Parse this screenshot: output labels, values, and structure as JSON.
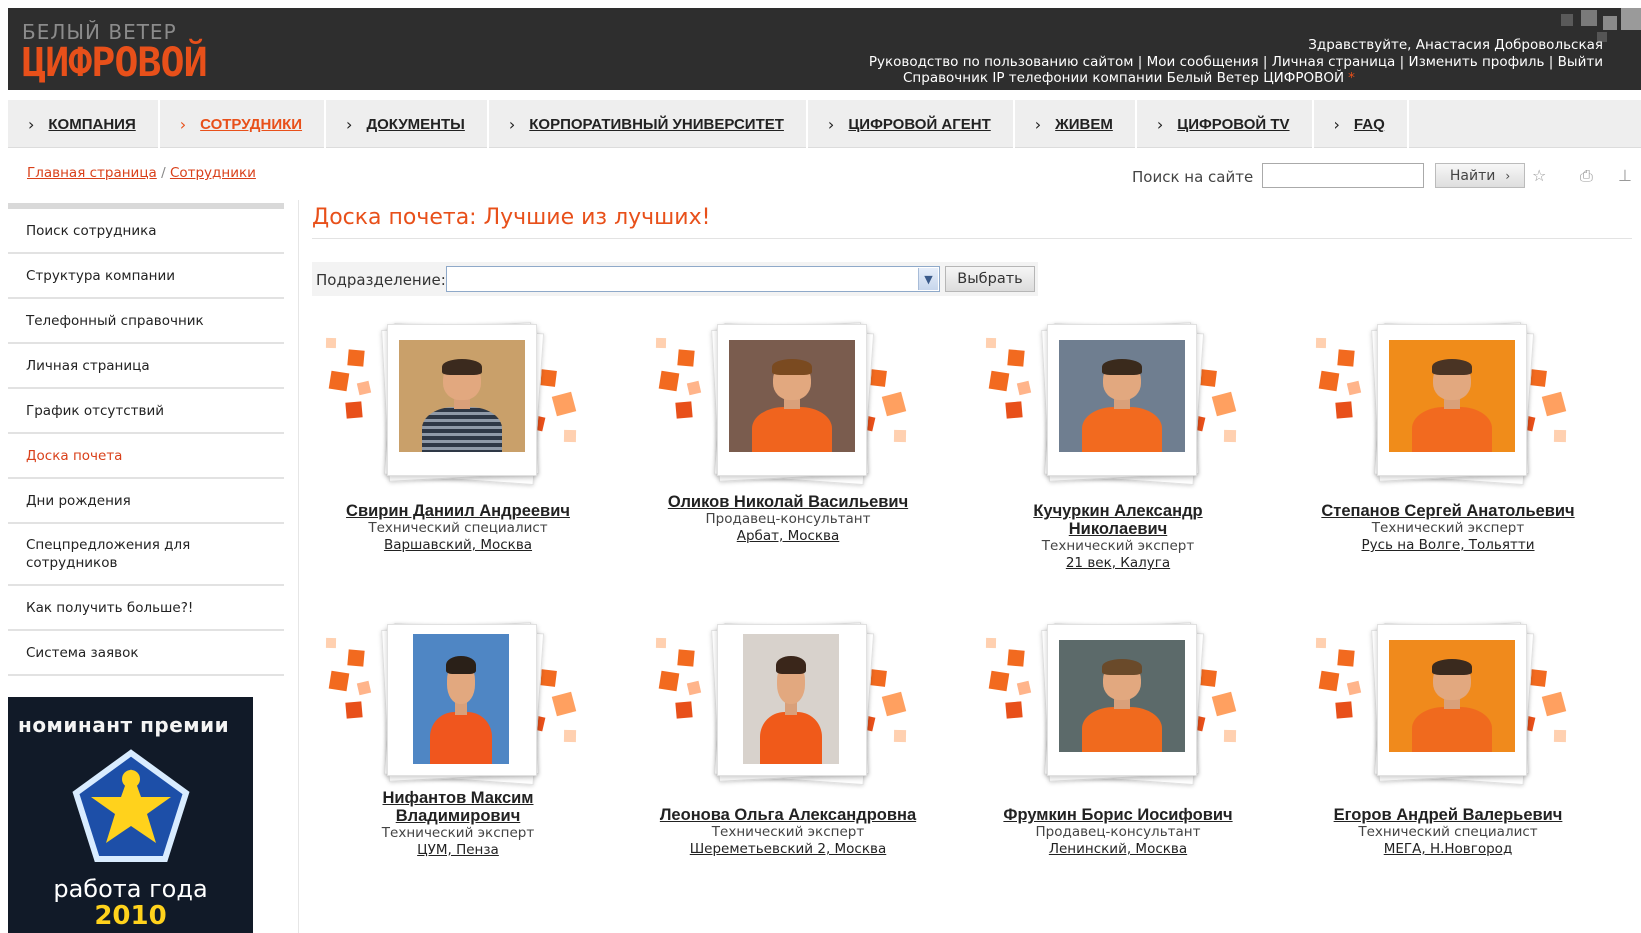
{
  "header": {
    "logo_top": "БЕЛЫЙ ВЕТЕР",
    "logo_main": "ЦИФРОВОЙ",
    "greeting": "Здравствуйте, Анастасия Добровольская",
    "links": [
      "Руководство по пользованию сайтом",
      "Мои сообщения",
      "Личная страница",
      "Изменить профиль",
      "Выйти"
    ],
    "phone_link": "Справочник IP телефонии компании Белый Ветер ЦИФРОВОЙ",
    "phone_mark": "*"
  },
  "nav": [
    {
      "label": "КОМПАНИЯ",
      "active": false
    },
    {
      "label": "СОТРУДНИКИ",
      "active": true
    },
    {
      "label": "ДОКУМЕНТЫ",
      "active": false
    },
    {
      "label": "КОРПОРАТИВНЫЙ УНИВЕРСИТЕТ",
      "active": false
    },
    {
      "label": "ЦИФРОВОЙ АГЕНТ",
      "active": false
    },
    {
      "label": "ЖИВЕМ",
      "active": false
    },
    {
      "label": "ЦИФРОВОЙ TV",
      "active": false
    },
    {
      "label": "FAQ",
      "active": false
    }
  ],
  "breadcrumb": {
    "home": "Главная страница",
    "separator": " / ",
    "current": "Сотрудники"
  },
  "search": {
    "label": "Поиск на сайте",
    "value": "",
    "button": "Найти"
  },
  "sidebar": [
    "Поиск сотрудника",
    "Структура компании",
    "Телефонный справочник",
    "Личная страница",
    "График отсутствий",
    "Доска почета",
    "Дни рождения",
    "Спецпредложения для сотрудников",
    "Как получить больше?!",
    "Система заявок"
  ],
  "sidebar_active": "Доска почета",
  "award": {
    "top": "номинант премии",
    "bottom": "работа года",
    "year": "2010"
  },
  "main": {
    "title": "Доска почета: Лучшие из лучших!",
    "filter_label": "Подразделение:",
    "filter_value": "",
    "filter_button": "Выбрать"
  },
  "employees": [
    {
      "name": "Свирин Даниил Андреевич",
      "role": "Технический специалист",
      "location": "Варшавский, Москва"
    },
    {
      "name": "Оликов Николай Васильевич",
      "role": "Продавец-консультант",
      "location": "Арбат, Москва"
    },
    {
      "name": "Кучуркин Александр Николаевич",
      "role": "Технический эксперт",
      "location": "21 век, Калуга"
    },
    {
      "name": "Степанов Сергей Анатольевич",
      "role": "Технический эксперт",
      "location": "Русь на Волге, Тольятти"
    },
    {
      "name": "Нифантов Максим Владимирович",
      "role": "Технический эксперт",
      "location": "ЦУМ, Пенза"
    },
    {
      "name": "Леонова Ольга Александровна",
      "role": "Технический эксперт",
      "location": "Шереметьевский 2, Москва"
    },
    {
      "name": "Фрумкин Борис Иосифович",
      "role": "Продавец-консультант",
      "location": "Ленинский, Москва"
    },
    {
      "name": "Егоров Андрей Валерьевич",
      "role": "Технический специалист",
      "location": "МЕГА, Н.Новгород"
    }
  ],
  "colors": {
    "accent": "#e8501a",
    "header_bg": "#2e2e2e",
    "nav_bg": "#eeeeee"
  }
}
